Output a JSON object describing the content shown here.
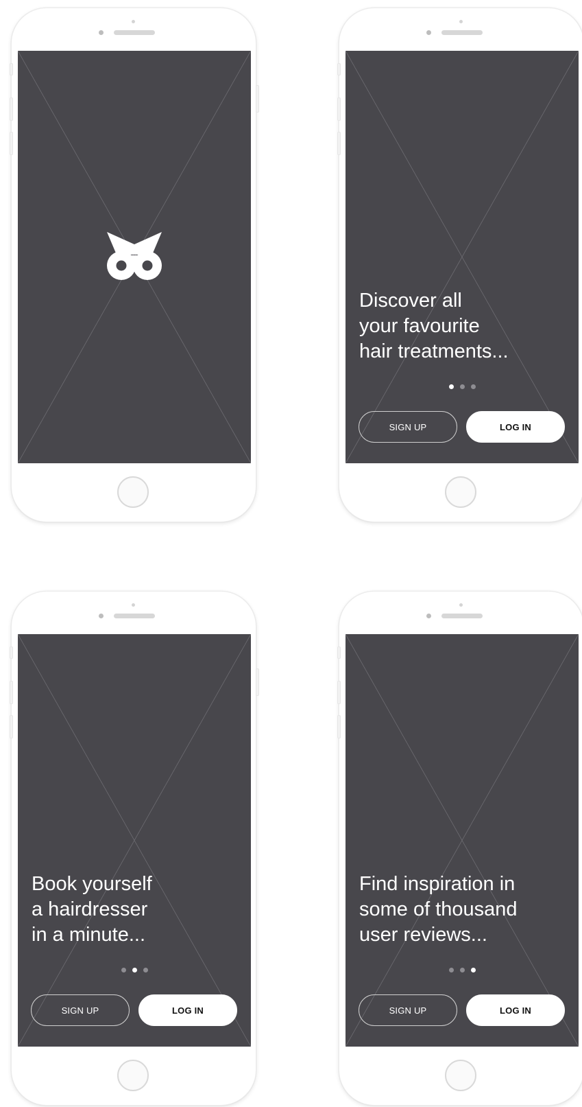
{
  "colors": {
    "screen_background": "#48474c",
    "device_body": "#ffffff",
    "text_primary": "#ffffff",
    "dot_active": "#ffffff",
    "dot_inactive": "#8e8d92",
    "login_button_background": "#ffffff",
    "login_button_text": "#111111"
  },
  "screens": [
    {
      "id": "splash",
      "icon": "owl-logo-icon"
    },
    {
      "id": "onboarding-1",
      "headline": [
        "Discover all",
        "your favourite",
        "hair treatments..."
      ],
      "active_page": 1,
      "page_count": 3,
      "signup_label": "SIGN UP",
      "login_label": "LOG IN"
    },
    {
      "id": "onboarding-2",
      "headline": [
        "Book yourself",
        "a hairdresser",
        "in a minute..."
      ],
      "active_page": 2,
      "page_count": 3,
      "signup_label": "SIGN UP",
      "login_label": "LOG IN"
    },
    {
      "id": "onboarding-3",
      "headline": [
        "Find inspiration in",
        "some of thousand",
        "user reviews..."
      ],
      "active_page": 3,
      "page_count": 3,
      "signup_label": "SIGN UP",
      "login_label": "LOG IN"
    }
  ]
}
